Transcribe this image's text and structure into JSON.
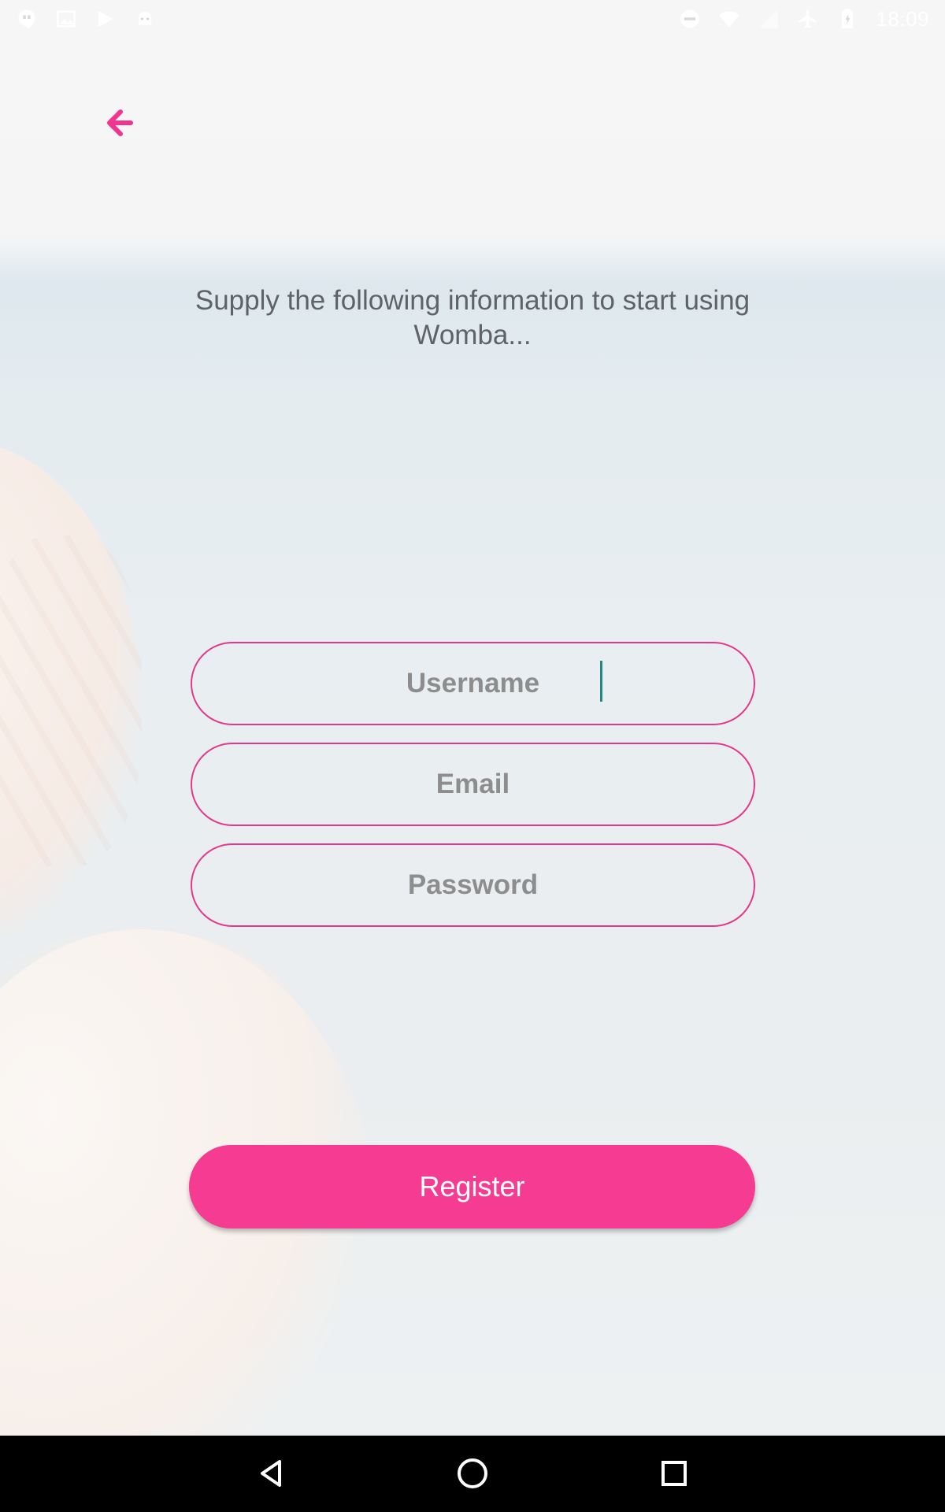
{
  "status_bar": {
    "time": "18:09",
    "left_icons": [
      "hangouts-icon",
      "image-icon",
      "play-store-icon",
      "android-icon"
    ],
    "right_icons": [
      "do-not-disturb-icon",
      "wifi-icon",
      "signal-icon",
      "airplane-icon",
      "battery-icon"
    ]
  },
  "header": {
    "back_icon": "arrow-left-icon"
  },
  "intro": {
    "text": "Supply the following information to start using Womba..."
  },
  "form": {
    "username": {
      "placeholder": "Username",
      "value": ""
    },
    "email": {
      "placeholder": "Email",
      "value": ""
    },
    "password": {
      "placeholder": "Password",
      "value": ""
    },
    "submit_label": "Register"
  },
  "nav_bar": {
    "icons": [
      "back-icon",
      "home-icon",
      "recents-icon"
    ]
  },
  "colors": {
    "accent": "#f63b92",
    "field_border": "#e4398a",
    "text": "#5f6368"
  }
}
